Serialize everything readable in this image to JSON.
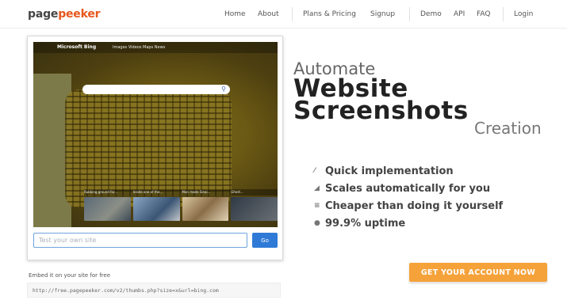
{
  "header": {
    "logo_part1": "page",
    "logo_part2": "peeker",
    "nav": {
      "home": "Home",
      "about": "About",
      "plans": "Plans & Pricing",
      "signup": "Signup",
      "demo": "Demo",
      "api": "API",
      "faq": "FAQ",
      "login": "Login"
    }
  },
  "preview": {
    "bing_logo": "Microsoft Bing",
    "bing_menu": "Images   Videos   Maps   News",
    "search_icon": "search-icon",
    "url_input_placeholder": "Test your own site",
    "go_label": "Go",
    "tile_captions": [
      "Rubbing ground for...",
      "Inside one of the...",
      "Man made Sinai...",
      "Ghost..."
    ]
  },
  "embed": {
    "label": "Embed it on your site for free",
    "code": "http://free.pagepeeker.com/v2/thumbs.php?size=x&url=bing.com"
  },
  "hero": {
    "line1": "Automate",
    "line2": "Website",
    "line3": "Screenshots",
    "line4": "Creation"
  },
  "features": [
    {
      "icon": "wand-icon",
      "glyph": "⁄",
      "label": "Quick implementation"
    },
    {
      "icon": "scale-icon",
      "glyph": "◢",
      "label": "Scales automatically for you"
    },
    {
      "icon": "list-icon",
      "glyph": "≡",
      "label": "Cheaper than doing it yourself"
    },
    {
      "icon": "circle-icon",
      "glyph": "●",
      "label": "99.9% uptime"
    }
  ],
  "cta": {
    "label": "GET YOUR ACCOUNT NOW"
  },
  "colors": {
    "brand": "#e8561c",
    "cta": "#f5a23a",
    "go": "#2f7ad6"
  }
}
